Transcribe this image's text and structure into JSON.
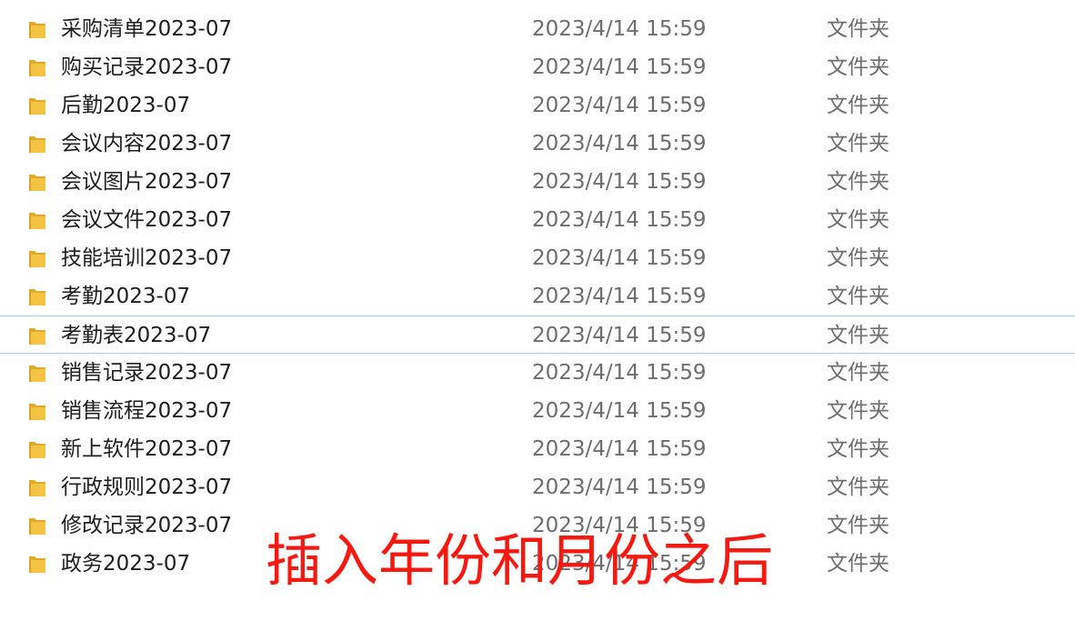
{
  "colors": {
    "name_text": "#1e1e1e",
    "meta_text": "#6d6d6d",
    "selection_border": "#9fd3e6",
    "folder_icon": "#f5c342",
    "caption": "#f41a12"
  },
  "files": [
    {
      "name": "采购清单2023-07",
      "date": "2023/4/14 15:59",
      "type": "文件夹",
      "icon": "folder-icon"
    },
    {
      "name": "购买记录2023-07",
      "date": "2023/4/14 15:59",
      "type": "文件夹",
      "icon": "folder-icon"
    },
    {
      "name": "后勤2023-07",
      "date": "2023/4/14 15:59",
      "type": "文件夹",
      "icon": "folder-icon"
    },
    {
      "name": "会议内容2023-07",
      "date": "2023/4/14 15:59",
      "type": "文件夹",
      "icon": "folder-icon"
    },
    {
      "name": "会议图片2023-07",
      "date": "2023/4/14 15:59",
      "type": "文件夹",
      "icon": "folder-icon"
    },
    {
      "name": "会议文件2023-07",
      "date": "2023/4/14 15:59",
      "type": "文件夹",
      "icon": "folder-icon"
    },
    {
      "name": "技能培训2023-07",
      "date": "2023/4/14 15:59",
      "type": "文件夹",
      "icon": "folder-icon"
    },
    {
      "name": "考勤2023-07",
      "date": "2023/4/14 15:59",
      "type": "文件夹",
      "icon": "folder-icon"
    },
    {
      "name": "考勤表2023-07",
      "date": "2023/4/14 15:59",
      "type": "文件夹",
      "icon": "folder-icon",
      "selected": true
    },
    {
      "name": "销售记录2023-07",
      "date": "2023/4/14 15:59",
      "type": "文件夹",
      "icon": "folder-icon"
    },
    {
      "name": "销售流程2023-07",
      "date": "2023/4/14 15:59",
      "type": "文件夹",
      "icon": "folder-icon"
    },
    {
      "name": "新上软件2023-07",
      "date": "2023/4/14 15:59",
      "type": "文件夹",
      "icon": "folder-icon"
    },
    {
      "name": "行政规则2023-07",
      "date": "2023/4/14 15:59",
      "type": "文件夹",
      "icon": "folder-icon"
    },
    {
      "name": "修改记录2023-07",
      "date": "2023/4/14 15:59",
      "type": "文件夹",
      "icon": "folder-icon"
    },
    {
      "name": "政务2023-07",
      "date": "2023/4/14 15:59",
      "type": "文件夹",
      "icon": "folder-icon"
    }
  ],
  "overlay": {
    "caption": "插入年份和月份之后"
  }
}
